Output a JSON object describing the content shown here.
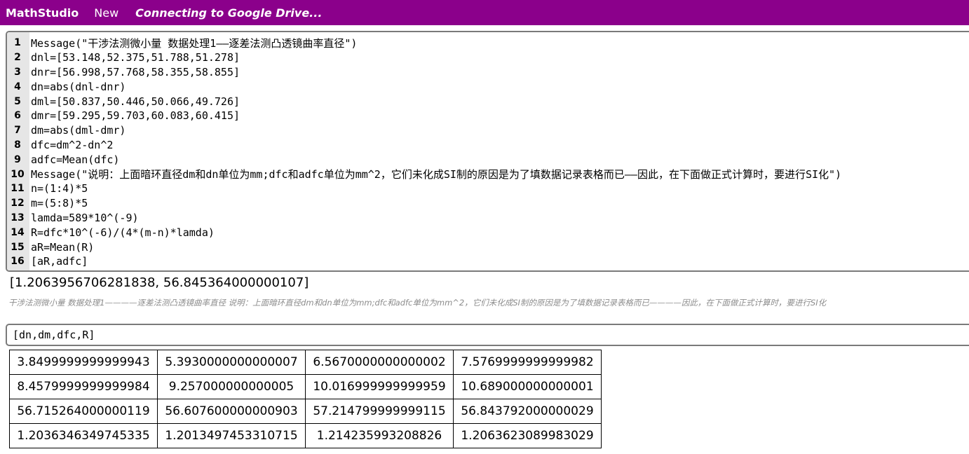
{
  "topbar": {
    "brand": "MathStudio",
    "new_label": "New",
    "status": "Connecting to Google Drive..."
  },
  "editor": {
    "lines": [
      {
        "num": "1",
        "code": "Message(\"干涉法测微小量 数据处理1——逐差法测凸透镜曲率直径\")"
      },
      {
        "num": "2",
        "code": "dnl=[53.148,52.375,51.788,51.278]"
      },
      {
        "num": "3",
        "code": "dnr=[56.998,57.768,58.355,58.855]"
      },
      {
        "num": "4",
        "code": "dn=abs(dnl-dnr)"
      },
      {
        "num": "5",
        "code": "dml=[50.837,50.446,50.066,49.726]"
      },
      {
        "num": "6",
        "code": "dmr=[59.295,59.703,60.083,60.415]"
      },
      {
        "num": "7",
        "code": "dm=abs(dml-dmr)"
      },
      {
        "num": "8",
        "code": "dfc=dm^2-dn^2"
      },
      {
        "num": "9",
        "code": "adfc=Mean(dfc)"
      },
      {
        "num": "10",
        "code": "Message(\"说明：上面暗环直径dm和dn单位为mm;dfc和adfc单位为mm^2，它们未化成SI制的原因是为了填数据记录表格而已——因此，在下面做正式计算时，要进行SI化\")"
      },
      {
        "num": "11",
        "code": "n=(1:4)*5"
      },
      {
        "num": "12",
        "code": "m=(5:8)*5"
      },
      {
        "num": "13",
        "code": "lamda=589*10^(-9)"
      },
      {
        "num": "14",
        "code": "R=dfc*10^(-6)/(4*(m-n)*lamda)"
      },
      {
        "num": "15",
        "code": "aR=Mean(R)"
      },
      {
        "num": "16",
        "code": "[aR,adfc]"
      }
    ]
  },
  "result": "[1.2063956706281838, 56.845364000000107]",
  "message": "干涉法测微小量 数据处理1————逐差法测凸透镜曲率直径 说明：上面暗环直径dm和dn单位为mm;dfc和adfc单位为mm^2，它们未化成SI制的原因是为了填数据记录表格而已————因此，在下面做正式计算时，要进行SI化",
  "editor2": {
    "code": "[dn,dm,dfc,R]"
  },
  "table": [
    [
      "3.8499999999999943",
      "5.3930000000000007",
      "6.5670000000000002",
      "7.5769999999999982"
    ],
    [
      "8.4579999999999984",
      "9.257000000000005",
      "10.016999999999959",
      "10.689000000000001"
    ],
    [
      "56.715264000000119",
      "56.607600000000903",
      "57.214799999999115",
      "56.843792000000029"
    ],
    [
      "1.2036346349745335",
      "1.2013497453310715",
      "1.214235993208826",
      "1.2063623089983029"
    ]
  ]
}
